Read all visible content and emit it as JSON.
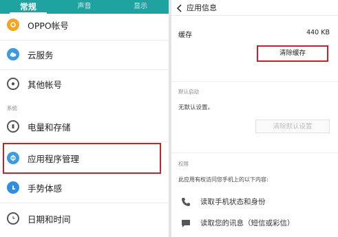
{
  "settings": {
    "tabs": [
      {
        "label": "常规"
      },
      {
        "label": "声音"
      },
      {
        "label": "显示"
      }
    ],
    "items": [
      {
        "label": "OPPO帐号",
        "icon": "oppo-account-icon",
        "color": "#f0a020"
      },
      {
        "label": "云服务",
        "icon": "cloud-icon",
        "color": "#3a9be0"
      },
      {
        "label": "其他帐号",
        "icon": "accounts-icon",
        "color": "#555555"
      },
      {
        "label": "电量和存储",
        "icon": "battery-storage-icon",
        "color": "#555555"
      },
      {
        "label": "应用程序管理",
        "icon": "app-management-icon",
        "color": "#3a9be0"
      },
      {
        "label": "手势体感",
        "icon": "gesture-icon",
        "color": "#2f8ee0"
      },
      {
        "label": "日期和时间",
        "icon": "clock-icon",
        "color": "#555555"
      }
    ],
    "system_section": "系统"
  },
  "app_info": {
    "title": "应用信息",
    "cache_label": "缓存",
    "cache_value": "440 KB",
    "clear_cache_label": "清除缓存",
    "default_launch_section": "默认启动",
    "no_defaults": "无默认设置。",
    "clear_defaults_label": "清除默认设置",
    "permissions_section": "权限",
    "permissions_intro": "此应用有权访问您手机上的以下内容:",
    "permissions": [
      {
        "label": "读取手机状态和身份",
        "icon": "phone-icon"
      },
      {
        "label": "读取您的讯息（短信或彩信）",
        "icon": "message-icon"
      }
    ]
  },
  "colors": {
    "tab_bar": "#1fa3a0",
    "highlight": "#c8202a"
  }
}
